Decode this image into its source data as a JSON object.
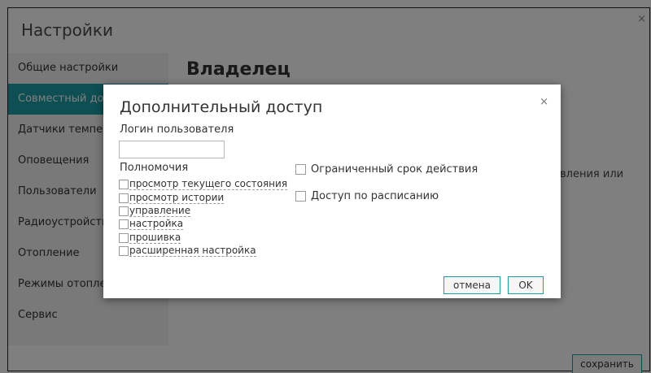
{
  "window": {
    "title": "Настройки",
    "close_glyph": "×"
  },
  "sidebar": {
    "items": [
      {
        "label": "Общие настройки",
        "active": false
      },
      {
        "label": "Совместный дост",
        "active": true
      },
      {
        "label": "Датчики темпера",
        "active": false
      },
      {
        "label": "Оповещения",
        "active": false
      },
      {
        "label": "Пользователи",
        "active": false
      },
      {
        "label": "Радиоустройства",
        "active": false
      },
      {
        "label": "Отопление",
        "active": false
      },
      {
        "label": "Режимы отоплен",
        "active": false
      },
      {
        "label": "Сервис",
        "active": false
      }
    ]
  },
  "main": {
    "section_title": "Владелец",
    "partial_text": "вления или",
    "save_label": "сохранить"
  },
  "dialog": {
    "title": "Дополнительный доступ",
    "close_glyph": "×",
    "login_label": "Логин пользователя",
    "login_value": "",
    "permissions_label": "Полномочия",
    "permissions": [
      "просмотр текущего состояния",
      "просмотр истории",
      "управление",
      "настройка",
      "прошивка",
      "расширенная настройка"
    ],
    "limited_validity_label": "Ограниченный срок действия",
    "schedule_access_label": "Доступ по расписанию",
    "cancel_label": "отмена",
    "ok_label": "OK"
  },
  "colors": {
    "accent": "#1a9ea6",
    "sidebar_bg": "#f3f3f3",
    "overlay": "rgba(0,0,0,0.5)"
  }
}
